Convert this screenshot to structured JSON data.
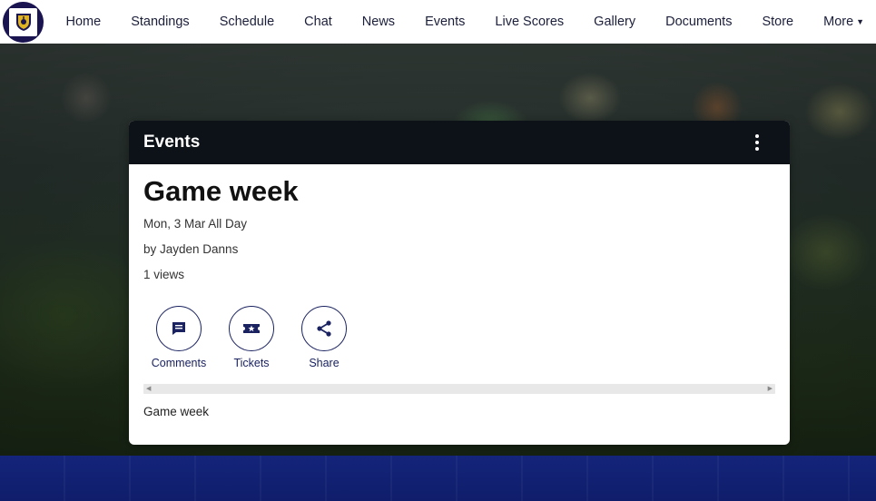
{
  "nav": {
    "logo_icon": "club-crest-icon",
    "items": [
      {
        "label": "Home"
      },
      {
        "label": "Standings"
      },
      {
        "label": "Schedule"
      },
      {
        "label": "Chat"
      },
      {
        "label": "News"
      },
      {
        "label": "Events"
      },
      {
        "label": "Live Scores"
      },
      {
        "label": "Gallery"
      },
      {
        "label": "Documents"
      },
      {
        "label": "Store"
      }
    ],
    "more_label": "More",
    "more_icon": "caret-down-icon"
  },
  "card": {
    "header_title": "Events",
    "menu_icon": "kebab-menu-icon",
    "event_title": "Game week",
    "date_line": "Mon, 3 Mar All Day",
    "author_line": "by Jayden Danns",
    "views_line": "1 views",
    "actions": [
      {
        "label": "Comments",
        "icon": "comment-icon"
      },
      {
        "label": "Tickets",
        "icon": "ticket-icon"
      },
      {
        "label": "Share",
        "icon": "share-icon"
      }
    ],
    "description": "Game week"
  },
  "colors": {
    "nav_text": "#1b1f3a",
    "logo_bg": "#1a1550",
    "card_header_bg": "#0d1218",
    "action_accent": "#1a2260",
    "footer_band": "#14247a"
  }
}
